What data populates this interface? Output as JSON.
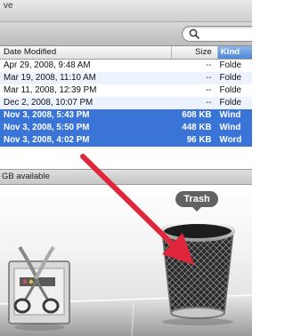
{
  "window": {
    "title_fragment": "ve"
  },
  "search": {
    "placeholder": ""
  },
  "columns": {
    "date_modified": "Date Modified",
    "size": "Size",
    "kind": "Kind"
  },
  "rows": [
    {
      "date": "Apr 29, 2008, 9:48 AM",
      "size": "--",
      "kind": "Folde",
      "selected": false
    },
    {
      "date": "Mar 19, 2008, 11:10 AM",
      "size": "--",
      "kind": "Folde",
      "selected": false
    },
    {
      "date": "Mar 11, 2008, 12:39 PM",
      "size": "--",
      "kind": "Folde",
      "selected": false
    },
    {
      "date": "Dec 2, 2008, 10:07 PM",
      "size": "--",
      "kind": "Folde",
      "selected": false
    },
    {
      "date": "Nov 3, 2008, 5:43 PM",
      "size": "608 KB",
      "kind": "Wind",
      "selected": true
    },
    {
      "date": "Nov 3, 2008, 5:50 PM",
      "size": "448 KB",
      "kind": "Wind",
      "selected": true
    },
    {
      "date": "Nov 3, 2008, 4:02 PM",
      "size": "96 KB",
      "kind": "Word",
      "selected": true
    }
  ],
  "status": {
    "text": "GB available"
  },
  "dock": {
    "trash_label": "Trash",
    "icons": [
      "screenshot-scissors-icon",
      "trash-icon"
    ]
  },
  "colors": {
    "selection": "#3a74d7",
    "arrow": "#e0263b"
  }
}
